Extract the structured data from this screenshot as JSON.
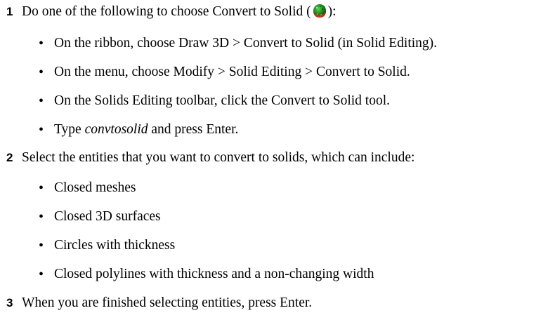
{
  "steps": [
    {
      "number": "1",
      "text_before_icon": "Do one of the following to choose Convert to Solid (",
      "text_after_icon": "):",
      "icon": "convert-to-solid-icon",
      "bullets": [
        "On the ribbon, choose Draw 3D > Convert to Solid (in Solid Editing).",
        "On the menu, choose Modify > Solid Editing > Convert to Solid.",
        "On the Solids Editing toolbar, click the Convert to Solid tool."
      ],
      "type_bullet": {
        "prefix": "Type ",
        "command": "convtosolid",
        "suffix": " and press Enter."
      }
    },
    {
      "number": "2",
      "text": "Select the entities that you want to convert to solids, which can include:",
      "bullets": [
        "Closed meshes",
        "Closed 3D surfaces",
        "Circles with thickness",
        "Closed polylines with thickness and a non-changing width"
      ]
    },
    {
      "number": "3",
      "text": "When you are finished selecting entities, press Enter."
    }
  ],
  "bullet_glyph": "•",
  "colors": {
    "text": "#000000",
    "icon_green": "#1c8a1c",
    "icon_red": "#c8321e"
  }
}
